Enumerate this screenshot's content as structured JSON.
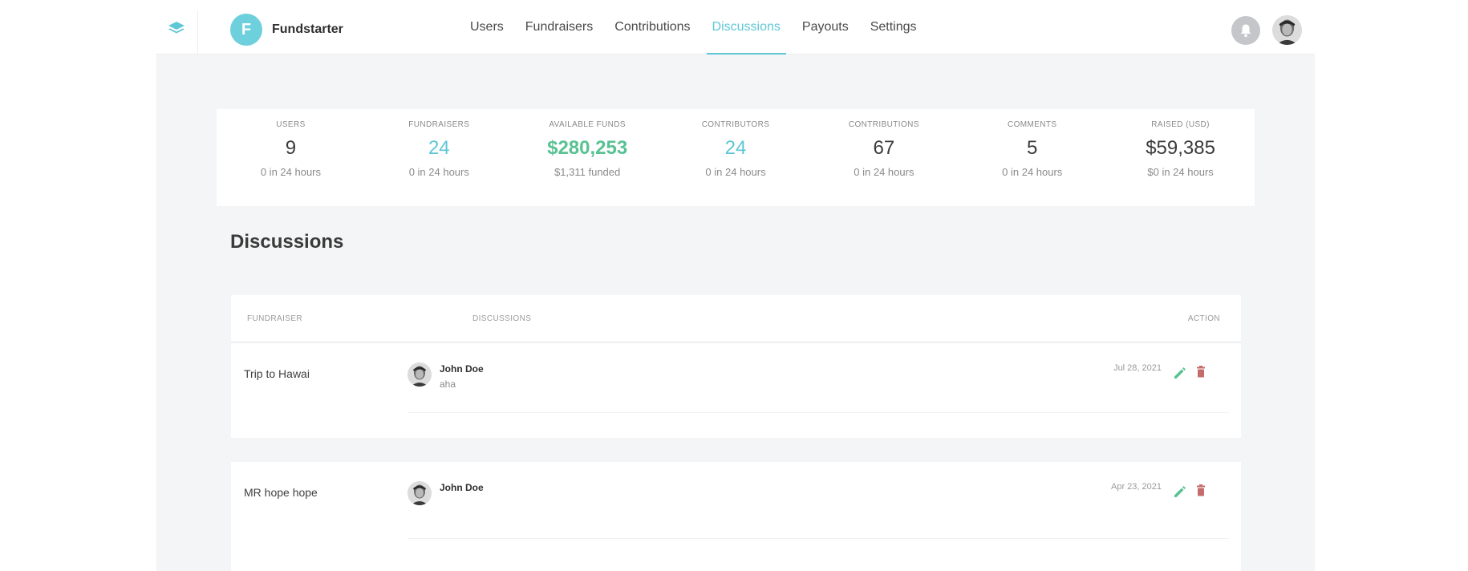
{
  "header": {
    "brand_initial": "F",
    "brand_name": "Fundstarter",
    "nav": [
      {
        "label": "Users",
        "active": false
      },
      {
        "label": "Fundraisers",
        "active": false
      },
      {
        "label": "Contributions",
        "active": false
      },
      {
        "label": "Discussions",
        "active": true
      },
      {
        "label": "Payouts",
        "active": false
      },
      {
        "label": "Settings",
        "active": false
      }
    ],
    "icons": {
      "menu": "layers-icon",
      "notifications": "bell-icon",
      "profile": "user-avatar"
    }
  },
  "stats": [
    {
      "label": "USERS",
      "value": "9",
      "sub": "0 in 24 hours",
      "color": "default"
    },
    {
      "label": "FUNDRAISERS",
      "value": "24",
      "sub": "0 in 24 hours",
      "color": "teal"
    },
    {
      "label": "AVAILABLE FUNDS",
      "value": "$280,253",
      "sub": "$1,311 funded",
      "color": "green"
    },
    {
      "label": "CONTRIBUTORS",
      "value": "24",
      "sub": "0 in 24 hours",
      "color": "teal"
    },
    {
      "label": "CONTRIBUTIONS",
      "value": "67",
      "sub": "0 in 24 hours",
      "color": "default"
    },
    {
      "label": "COMMENTS",
      "value": "5",
      "sub": "0 in 24 hours",
      "color": "default"
    },
    {
      "label": "RAISED (USD)",
      "value": "$59,385",
      "sub": "$0 in 24 hours",
      "color": "default"
    }
  ],
  "page": {
    "title": "Discussions"
  },
  "table": {
    "columns": {
      "fundraiser": "FUNDRAISER",
      "discussions": "DISCUSSIONS",
      "action": "ACTION"
    },
    "rows": [
      {
        "fundraiser": "Trip to Hawai",
        "author": "John Doe",
        "text": "aha",
        "date": "Jul 28, 2021"
      },
      {
        "fundraiser": "MR hope hope",
        "author": "John Doe",
        "text": "",
        "date": "Apr 23, 2021"
      }
    ]
  },
  "colors": {
    "accent": "#5fc7d6",
    "positive": "#58c292",
    "danger": "#c46b6b",
    "background": "#f4f5f6"
  }
}
